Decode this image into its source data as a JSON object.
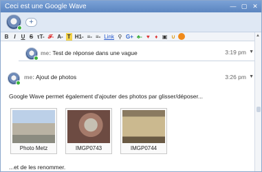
{
  "window": {
    "title": "Ceci est une Google Wave",
    "controls": [
      "—",
      "▢",
      "✕"
    ]
  },
  "participants": {
    "add_label": "+"
  },
  "toolbar": {
    "items": [
      "B",
      "I",
      "U",
      "S",
      "τT-",
      "𝓕-",
      "A-",
      "T",
      "H1-",
      "≡-",
      "≡-",
      "Link",
      "⚲",
      "G+",
      "♣-",
      "♥",
      "♦",
      "▣",
      "∪",
      ""
    ]
  },
  "reply": {
    "author": "me:",
    "text": "Test de réponse dans une vague",
    "time": "3:19 pm",
    "caret": "▼"
  },
  "blip": {
    "author": "me:",
    "title": "Ajout de photos",
    "time": "3:26 pm",
    "caret": "▼",
    "body": "Google Wave permet également d'ajouter des photos par glisser/déposer...",
    "photos": [
      {
        "caption": "Photo Metz"
      },
      {
        "caption": "IMGP0743"
      },
      {
        "caption": "IMGP0744"
      }
    ],
    "footer": "...et de les renommer."
  }
}
